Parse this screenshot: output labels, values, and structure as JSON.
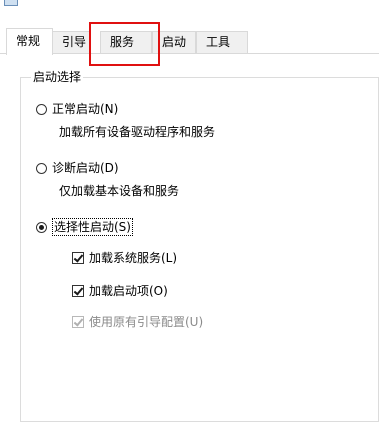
{
  "tabs": [
    {
      "label": "常规",
      "selected": true
    },
    {
      "label": "引导",
      "selected": false
    },
    {
      "label": "服务",
      "selected": false
    },
    {
      "label": "启动",
      "selected": false
    },
    {
      "label": "工具",
      "selected": false
    }
  ],
  "highlight_color": "#e01010",
  "startup_group": {
    "title": "启动选择",
    "options": {
      "normal": {
        "label": "正常启动(N)",
        "description": "加载所有设备驱动程序和服务",
        "selected": false
      },
      "diagnostic": {
        "label": "诊断启动(D)",
        "description": "仅加载基本设备和服务",
        "selected": false
      },
      "selective": {
        "label": "选择性启动(S)",
        "selected": true
      }
    },
    "selective_items": {
      "load_system_services": {
        "label": "加载系统服务(L)",
        "checked": true,
        "enabled": true
      },
      "load_startup_items": {
        "label": "加载启动项(O)",
        "checked": true,
        "enabled": true
      },
      "use_original_boot": {
        "label": "使用原有引导配置(U)",
        "checked": true,
        "enabled": false
      }
    }
  }
}
